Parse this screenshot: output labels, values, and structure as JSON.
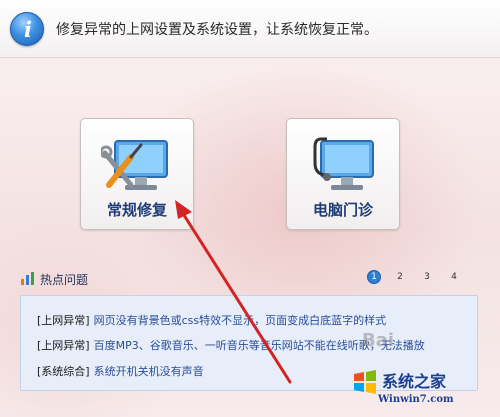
{
  "header": {
    "title": "修复异常的上网设置及系统设置，让系统恢复正常。",
    "icon": "info-icon"
  },
  "tiles": [
    {
      "label": "常规修复",
      "icon": "monitor-tools-icon"
    },
    {
      "label": "电脑门诊",
      "icon": "monitor-stethoscope-icon"
    }
  ],
  "hot": {
    "title": "热点问题",
    "pages": [
      "1",
      "2",
      "3",
      "4"
    ],
    "active_page": "1",
    "items": [
      {
        "tag": "[上网异常]",
        "text": "网页没有背景色或css特效不显示，页面变成白底蓝字的样式"
      },
      {
        "tag": "[上网异常]",
        "text": "百度MP3、谷歌音乐、一听音乐等音乐网站不能在线听歌，无法播放"
      },
      {
        "tag": "[系统综合]",
        "text": "系统开机关机没有声音"
      }
    ]
  },
  "watermark": {
    "baidu": "Bai",
    "site": "系统之家",
    "url": "Winwin7.com"
  },
  "colors": {
    "accent": "#2f7fd6",
    "tile_label": "#1f3d78",
    "link": "#2a4d9a",
    "arrow": "#d32424"
  }
}
